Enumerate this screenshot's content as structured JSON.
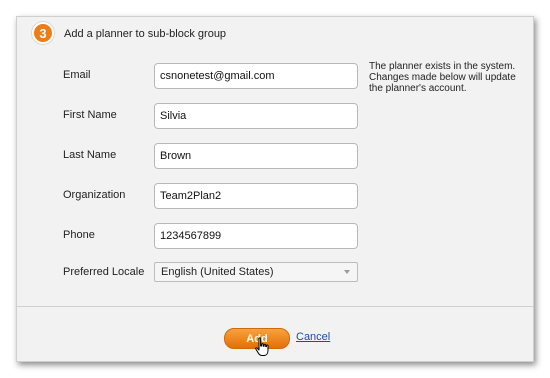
{
  "header": {
    "step_number": "3",
    "title": "Add a planner to sub-block group"
  },
  "form": {
    "email": {
      "label": "Email",
      "value": "csnonetest@gmail.com"
    },
    "first_name": {
      "label": "First Name",
      "value": "Silvia"
    },
    "last_name": {
      "label": "Last Name",
      "value": "Brown"
    },
    "organization": {
      "label": "Organization",
      "value": "Team2Plan2"
    },
    "phone": {
      "label": "Phone",
      "value": "1234567899"
    },
    "locale": {
      "label": "Preferred Locale",
      "value": "English (United States)"
    }
  },
  "note": "The planner exists in the system. Changes made below will update the planner's account.",
  "actions": {
    "add_label": "Add",
    "cancel_label": "Cancel"
  },
  "colors": {
    "accent": "#ef7d15",
    "link": "#1a4fa3",
    "panel_bg": "#f2f2f2"
  },
  "icons": {
    "step": "step-number-badge",
    "cursor": "hand-pointer-icon",
    "select_arrow": "chevron-down-icon"
  }
}
